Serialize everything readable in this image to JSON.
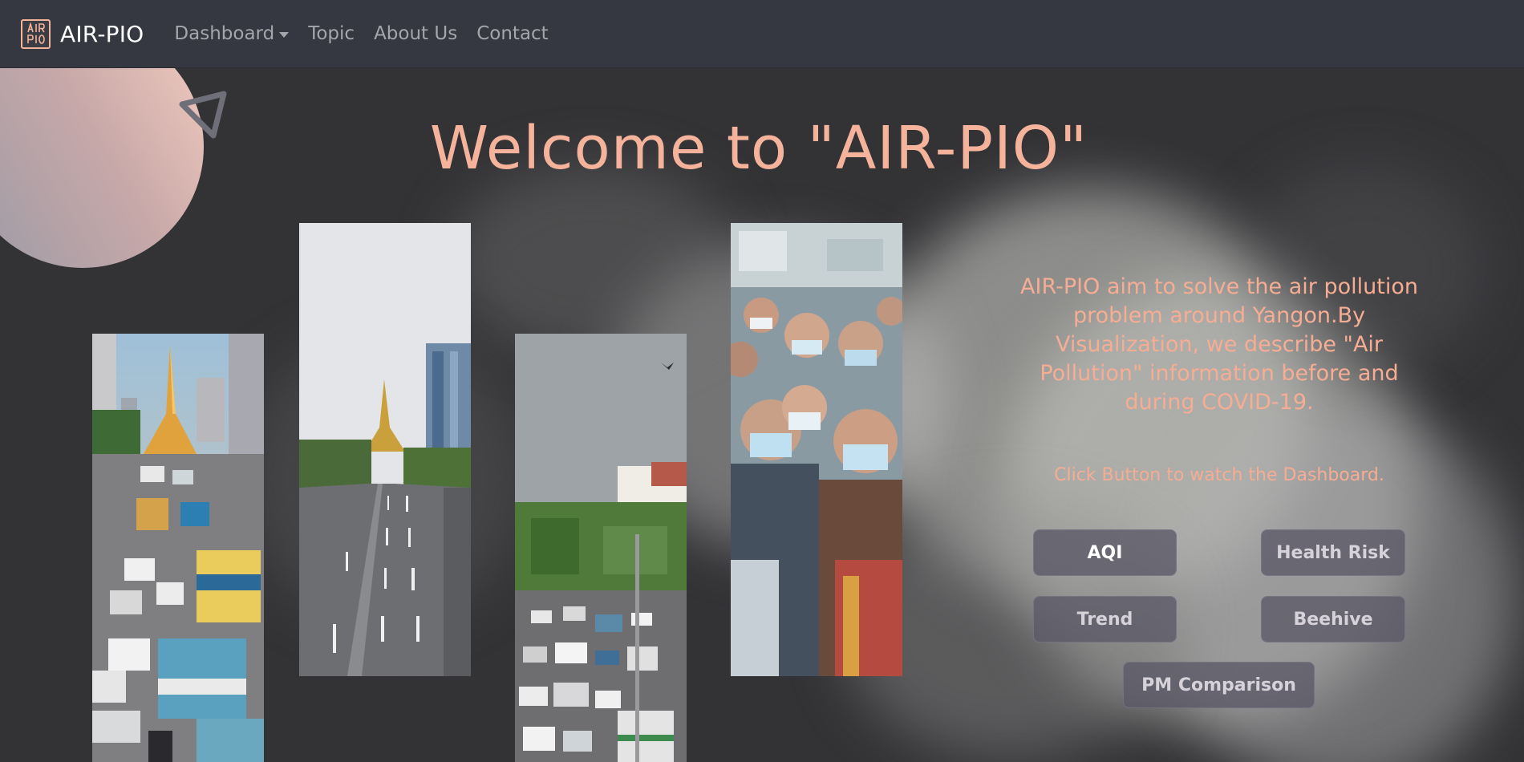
{
  "navbar": {
    "brand": "AIR-PIO",
    "links": [
      {
        "label": "Dashboard",
        "dropdown": true
      },
      {
        "label": "Topic"
      },
      {
        "label": "About Us"
      },
      {
        "label": "Contact"
      }
    ]
  },
  "hero": {
    "title": "Welcome to \"AIR-PIO\""
  },
  "info": {
    "description": "AIR-PIO aim to solve the air pollution problem around Yangon.By Visualization, we describe \"Air Pollution\" information before and during COVID-19.",
    "hint": "Click Button to watch the Dashboard."
  },
  "buttons": {
    "aqi": "AQI",
    "health_risk": "Health Risk",
    "trend": "Trend",
    "beehive": "Beehive",
    "pm_comparison": "PM Comparison"
  },
  "colors": {
    "accent": "#f6b39b",
    "navbar_bg": "#353840",
    "page_bg": "#333336",
    "button_bg": "#5a5867"
  },
  "icons": {
    "brand_logo": "air-pio-logo-icon",
    "dropdown": "caret-down-icon",
    "decor_triangle": "triangle-outline-icon"
  }
}
